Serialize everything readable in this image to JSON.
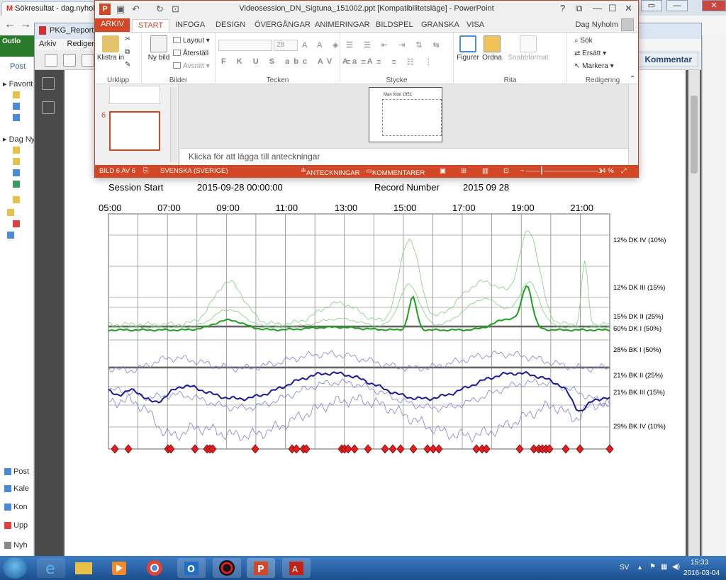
{
  "browser": {
    "tab_title": "Sökresultat - dag.nyholm",
    "outlook_logo_label": "Outlo"
  },
  "outlook": {
    "post_label": "Post",
    "favorites_label": "Favorit",
    "account_label": "Dag Ny",
    "bottom_items": [
      "Post",
      "Kale",
      "Kon",
      "Upp",
      "Nyh"
    ]
  },
  "pdf": {
    "title": "PKG_Report-D",
    "menu": [
      "Arkiv",
      "Redigera"
    ],
    "right_button": "Kommentar"
  },
  "ppt": {
    "title": "Videosession_DN_Sigtuna_151002.ppt [Kompatibilitetsläge] - PowerPoint",
    "user": "Dag Nyholm",
    "tabs": [
      "ARKIV",
      "START",
      "INFOGA",
      "DESIGN",
      "ÖVERGÅNGAR",
      "ANIMERINGAR",
      "BILDSPEL",
      "GRANSKA",
      "VISA"
    ],
    "active_tab": "START",
    "ribbon": {
      "clipboard_label": "Klistra in",
      "clipboard_group": "Urklipp",
      "new_slide_label": "Ny bild",
      "layout_label": "Layout",
      "reset_label": "Återställ",
      "section_label": "Avsnitt",
      "slides_group": "Bilder",
      "font_size": "28",
      "font_group": "Tecken",
      "paragraph_group": "Stycke",
      "shapes_label": "Figurer",
      "arrange_label": "Ordna",
      "quickstyles_label": "Snabbformat",
      "drawing_group": "Rita",
      "find_label": "Sök",
      "replace_label": "Ersätt",
      "select_label": "Markera",
      "editing_group": "Redigering"
    },
    "thumb_number": "6",
    "slide_title": "Man född 1951",
    "notes_placeholder": "Klicka för att lägga till anteckningar",
    "status": {
      "slide_info": "BILD 6 AV 6",
      "language": "SVENSKA (SVERIGE)",
      "notes": "ANTECKNINGAR",
      "comments": "KOMMENTARER",
      "zoom": "14 %"
    }
  },
  "report": {
    "session_start_label": "Session Start",
    "session_start_value": "2015-09-28 00:00:00",
    "record_label": "Record Number",
    "record_value": "2015 09 28"
  },
  "chart_data": {
    "type": "line",
    "x_ticks": [
      "05:00",
      "07:00",
      "09:00",
      "11:00",
      "13:00",
      "15:00",
      "17:00",
      "19:00",
      "21:00"
    ],
    "right_labels": [
      {
        "text": "12% DK IV (10%)",
        "y": 338
      },
      {
        "text": "12% DK III (15%)",
        "y": 405
      },
      {
        "text": "15% DK II (25%)",
        "y": 446
      },
      {
        "text": "60% DK I (50%)",
        "y": 463
      },
      {
        "text": "28% BK I (50%)",
        "y": 493
      },
      {
        "text": "21% BK II (25%)",
        "y": 529
      },
      {
        "text": "21% BK III (15%)",
        "y": 553
      },
      {
        "text": "29% BK IV (10%)",
        "y": 601
      }
    ],
    "colors": {
      "dk_bold": "#1aa31a",
      "dk_light": "#7fd07f",
      "bk_bold": "#1a1aa0",
      "bk_light": "#8080d8",
      "marker": "#e02020"
    }
  },
  "taskbar": {
    "lang": "SV",
    "time": "15:33",
    "date": "2016-03-04"
  }
}
